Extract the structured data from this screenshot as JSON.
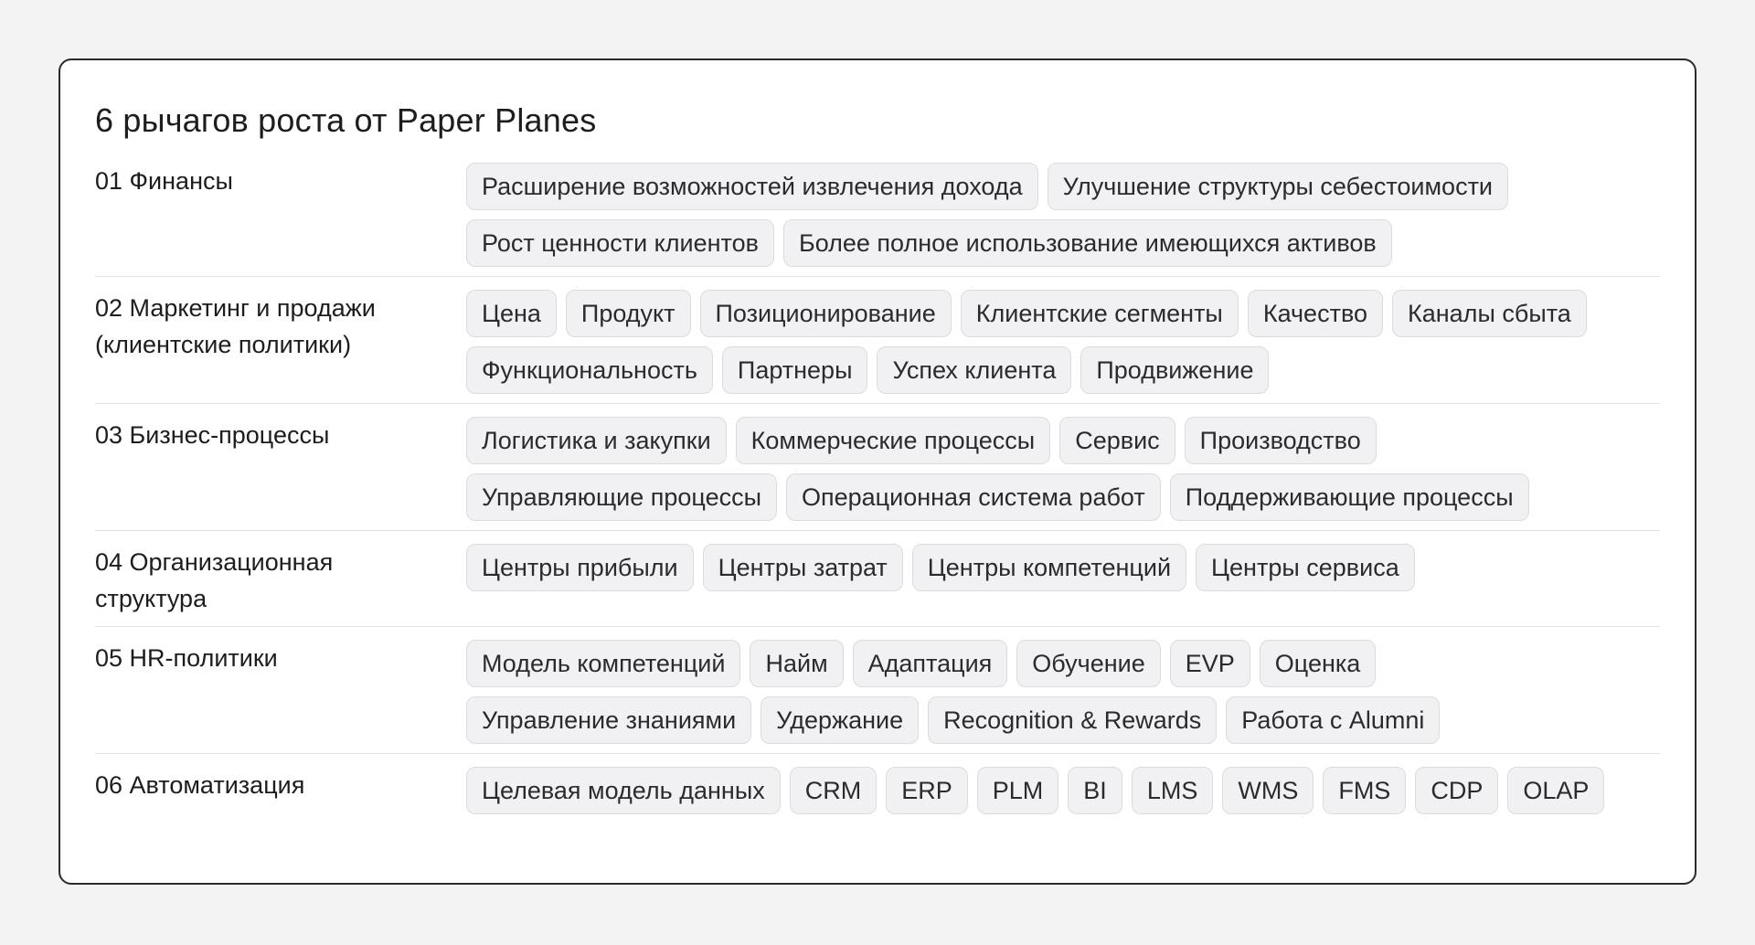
{
  "card": {
    "title": "6 рычагов роста от Paper Planes"
  },
  "rows": [
    {
      "label": "01 Финансы",
      "tags": [
        "Расширение возможностей извлечения дохода",
        "Улучшение структуры себестоимости",
        "Рост ценности клиентов",
        "Более полное использование имеющихся активов"
      ]
    },
    {
      "label": "02 Маркетинг и продажи (клиентские политики)",
      "tags": [
        "Цена",
        "Продукт",
        "Позиционирование",
        "Клиентские сегменты",
        "Качество",
        "Каналы сбыта",
        "Функциональность",
        "Партнеры",
        "Успех клиента",
        "Продвижение"
      ]
    },
    {
      "label": "03 Бизнес-процессы",
      "tags": [
        "Логистика и закупки",
        "Коммерческие процессы",
        "Сервис",
        "Производство",
        "Управляющие процессы",
        "Операционная система работ",
        "Поддерживающие процессы"
      ]
    },
    {
      "label": "04 Организационная структура",
      "tags": [
        "Центры прибыли",
        "Центры затрат",
        "Центры компетенций",
        "Центры сервиса"
      ]
    },
    {
      "label": "05 HR-политики",
      "tags": [
        "Модель компетенций",
        "Найм",
        "Адаптация",
        "Обучение",
        "EVP",
        "Оценка",
        "Управление знаниями",
        "Удержание",
        "Recognition & Rewards",
        "Работа с Alumni"
      ]
    },
    {
      "label": "06 Автоматизация",
      "tags": [
        "Целевая модель данных",
        "CRM",
        "ERP",
        "PLM",
        "BI",
        "LMS",
        "WMS",
        "FMS",
        "CDP",
        "OLAP"
      ]
    }
  ]
}
